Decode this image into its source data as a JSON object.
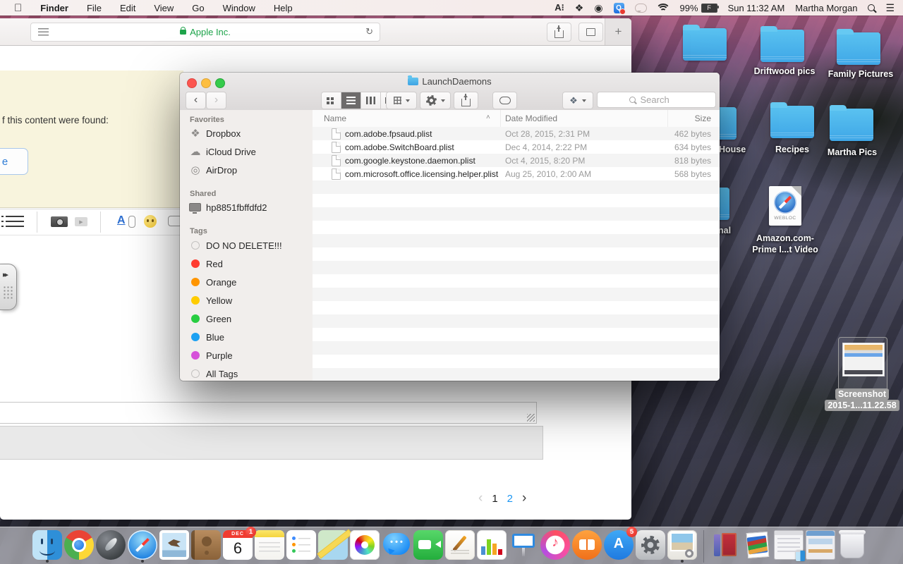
{
  "menu_bar": {
    "items": [
      "Finder",
      "File",
      "Edit",
      "View",
      "Go",
      "Window",
      "Help"
    ],
    "status": {
      "battery": "99%",
      "clock": "Sun 11:32 AM",
      "user": "Martha Morgan"
    }
  },
  "safari": {
    "address": "Apple Inc.",
    "content_fragment": "f this content were found:",
    "button_fragment": "e",
    "pagination": {
      "page1": "1",
      "page2": "2"
    }
  },
  "finder": {
    "title": "LaunchDaemons",
    "search_placeholder": "Search",
    "sidebar": {
      "favorites_label": "Favorites",
      "favorites": [
        {
          "label": "Dropbox"
        },
        {
          "label": "iCloud Drive"
        },
        {
          "label": "AirDrop"
        }
      ],
      "shared_label": "Shared",
      "shared": [
        {
          "label": "hp8851fbffdfd2"
        }
      ],
      "tags_label": "Tags",
      "tags": [
        {
          "label": "DO NO DELETE!!!",
          "color": "#c4c2c0",
          "outline": true
        },
        {
          "label": "Red",
          "color": "#ff3b30"
        },
        {
          "label": "Orange",
          "color": "#ff9500"
        },
        {
          "label": "Yellow",
          "color": "#ffcc00"
        },
        {
          "label": "Green",
          "color": "#28cd41"
        },
        {
          "label": "Blue",
          "color": "#1da1f2"
        },
        {
          "label": "Purple",
          "color": "#d651d9"
        },
        {
          "label": "All Tags",
          "color": "#c4c2c0",
          "outline": true
        }
      ]
    },
    "columns": {
      "name": "Name",
      "date": "Date Modified",
      "size": "Size"
    },
    "files": [
      {
        "name": "com.adobe.fpsaud.plist",
        "date": "Oct 28, 2015, 2:31 PM",
        "size": "462 bytes"
      },
      {
        "name": "com.adobe.SwitchBoard.plist",
        "date": "Dec 4, 2014, 2:22 PM",
        "size": "634 bytes"
      },
      {
        "name": "com.google.keystone.daemon.plist",
        "date": "Oct 4, 2015, 8:20 PM",
        "size": "818 bytes"
      },
      {
        "name": "com.microsoft.office.licensing.helper.plist",
        "date": "Aug 25, 2010, 2:00 AM",
        "size": "568 bytes"
      }
    ]
  },
  "desktop": {
    "driftwood": "Driftwood pics",
    "family": "Family Pictures",
    "house": "House",
    "recipes": "Recipes",
    "martha": "Martha Pics",
    "partial_folder": "nal",
    "webloc_line1": "Amazon.com-",
    "webloc_line2": "Prime I...t Video",
    "webloc_badge": "WEBLOC",
    "screenshot_line1": "Screenshot",
    "screenshot_line2": "2015-1...11.22.58"
  },
  "dock": {
    "calendar_month": "DEC",
    "calendar_day": "6",
    "calendar_badge": "1",
    "appstore_badge": "5",
    "apps": [
      "Finder",
      "Google Chrome",
      "Launchpad",
      "Safari",
      "Mail",
      "Contacts",
      "Calendar",
      "Notes",
      "Reminders",
      "Maps",
      "Photos",
      "Messages",
      "FaceTime",
      "Pages",
      "Numbers",
      "Keynote",
      "iTunes",
      "iBooks",
      "App Store",
      "System Preferences",
      "Preview",
      "Documents stack",
      "Books stack",
      "Minimized window",
      "Minimized window",
      "Trash"
    ]
  },
  "icons": {
    "menu_status": [
      "adobe-cc",
      "dropbox",
      "eye",
      "quicktime-q",
      "chat-bubble",
      "wifi",
      "battery-charging",
      "search",
      "notification-center"
    ],
    "finder_toolbar": [
      "back",
      "forward",
      "icon-view",
      "list-view",
      "column-view",
      "coverflow-view",
      "arrange",
      "action-gear",
      "share",
      "tag",
      "dropbox-menu",
      "search"
    ]
  }
}
